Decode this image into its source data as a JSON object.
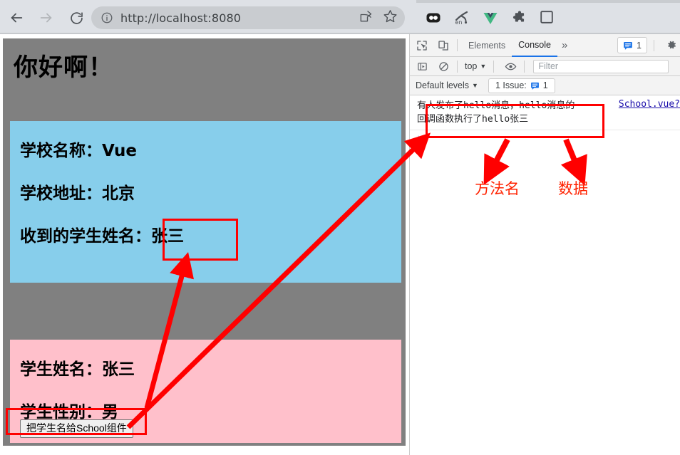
{
  "browser": {
    "url": "http://localhost:8080",
    "nav": {
      "back": "back-arrow",
      "forward": "forward-arrow",
      "reload": "reload-arrow",
      "site_info": "info-circle-icon"
    },
    "omnibox_actions": [
      "share-icon",
      "bookmark-star-icon"
    ],
    "extensions": [
      "dark-glasses-extension-icon",
      "translate-en-extension-icon",
      "vue-devtools-icon",
      "puzzle-extensions-icon",
      "side-panel-icon"
    ]
  },
  "page": {
    "title": "你好啊！",
    "school": {
      "name_label": "学校名称：",
      "name_value": "Vue",
      "address_label": "学校地址：",
      "address_value": "北京",
      "received_label": "收到的学生姓名：",
      "received_value": "张三"
    },
    "student": {
      "name_label": "学生姓名：",
      "name_value": "张三",
      "sex_label": "学生性别：",
      "sex_value": "男",
      "button_label": "把学生名给School组件"
    },
    "colors": {
      "page_bg": "#808080",
      "school_bg": "#87ceeb",
      "student_bg": "#ffc0cb"
    }
  },
  "devtools": {
    "toolbar_icons": [
      "inspect-element-icon",
      "device-toolbar-icon"
    ],
    "tabs": [
      {
        "label": "Elements",
        "active": false
      },
      {
        "label": "Console",
        "active": true
      }
    ],
    "more_tabs": "»",
    "issue_chip_count": "1",
    "settings_icon": "gear-icon",
    "console_toolbar": {
      "sidebar_icon": "console-sidebar-icon",
      "clear_icon": "clear-console-icon",
      "context": "top",
      "eye_icon": "live-expression-eye-icon",
      "filter_placeholder": "Filter"
    },
    "levels_row": {
      "levels_label": "Default levels",
      "issues_label": "1 Issue:",
      "issues_count": "1"
    },
    "console_message": {
      "line1_a": "有人发布了",
      "line1_b": "hello",
      "line1_c": "消息，",
      "line1_d": "hello",
      "line1_e": "消息的",
      "line2_a": "回调函数执行了",
      "line2_b": "hello",
      "line2_c": "张三",
      "source_link": "School.vue?",
      "prompt": "›"
    }
  },
  "annotations": {
    "accent_color": "#ff0000",
    "method_name_label": "方法名",
    "data_label": "数据"
  }
}
